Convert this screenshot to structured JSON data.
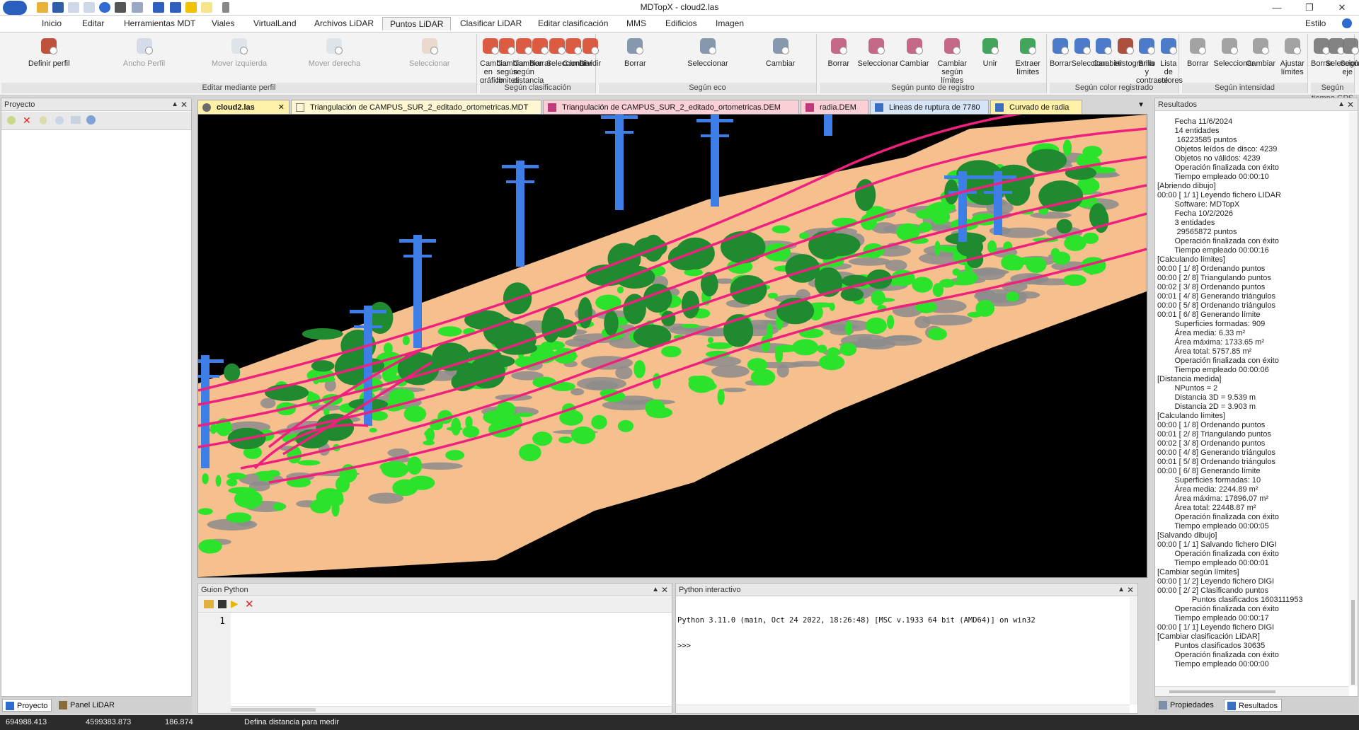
{
  "window": {
    "title": "MDTopX - cloud2.las",
    "controls": [
      "minimize-icon",
      "restore-icon",
      "close-icon"
    ]
  },
  "quick_access": [
    "app-logo-icon",
    "open-icon",
    "save-icon",
    "undo-icon",
    "redo-icon",
    "info-icon",
    "print-icon",
    "dropdown-icon",
    "forward-icon",
    "back-icon",
    "star-icon",
    "note-icon",
    "customize-icon"
  ],
  "menu": {
    "tabs": [
      "Inicio",
      "Editar",
      "Herramientas MDT",
      "Viales",
      "VirtualLand",
      "Archivos LiDAR",
      "Puntos LiDAR",
      "Clasificar LiDAR",
      "Editar clasificación",
      "MMS",
      "Edificios",
      "Imagen"
    ],
    "active": "Puntos LiDAR",
    "style_label": "Estilo"
  },
  "ribbon": {
    "groups": [
      {
        "label": "Editar mediante perfil",
        "buttons": [
          "Definir perfil",
          "Ancho Perfil",
          "Mover izquierda",
          "Mover derecha",
          "Seleccionar"
        ]
      },
      {
        "label": "Según clasificación",
        "buttons": [
          "Cambiar en gráfico",
          "Cambiar según límites",
          "Cambiar según distancia",
          "Borrar",
          "Seleccionar",
          "Cambiar",
          "Dividir"
        ]
      },
      {
        "label": "Según eco",
        "buttons": [
          "Borrar",
          "Seleccionar",
          "Cambiar"
        ]
      },
      {
        "label": "Según punto de registro",
        "buttons": [
          "Borrar",
          "Seleccionar",
          "Cambiar",
          "Cambiar según límites",
          "Unir",
          "Extraer límites"
        ]
      },
      {
        "label": "Según color registrado",
        "buttons": [
          "Borrar",
          "Seleccionar",
          "Cambiar",
          "Histograma",
          "Brillo y contraste",
          "Lista de colores"
        ]
      },
      {
        "label": "Según intensidad",
        "buttons": [
          "Borrar",
          "Seleccionar",
          "Cambiar",
          "Ajustar límites"
        ]
      },
      {
        "label": "Según tiempo GPS",
        "buttons": [
          "Borrar",
          "Seleccionar",
          "Según eje"
        ]
      }
    ]
  },
  "project_panel": {
    "title": "Proyecto",
    "bottom_tabs": [
      "Proyecto",
      "Panel LiDAR"
    ]
  },
  "document_tabs": [
    {
      "label": "cloud2.las",
      "active": true
    },
    {
      "label": "Triangulación de CAMPUS_SUR_2_editado_ortometricas.MDT",
      "active": false
    },
    {
      "label": "Triangulación de CAMPUS_SUR_2_editado_ortometricas.DEM",
      "active": false
    },
    {
      "label": "radia.DEM",
      "active": false
    },
    {
      "label": "Lineas de ruptura de 7780",
      "active": false
    },
    {
      "label": "Curvado de radia",
      "active": false
    }
  ],
  "guion_python": {
    "title": "Guion Python",
    "line_number": "1"
  },
  "python_interactive": {
    "title": "Python interactivo",
    "banner": "Python 3.11.0 (main, Oct 24 2022, 18:26:48) [MSC v.1933 64 bit (AMD64)] on win32",
    "prompt": ">>>"
  },
  "results_panel": {
    "title": "Resultados",
    "lines": [
      "        Fecha 11/6/2024",
      "        14 entidades",
      "         16223585 puntos",
      "        Objetos leídos de disco: 4239",
      "        Objetos no válidos: 4239",
      "        Operación finalizada con éxito",
      "        Tiempo empleado 00:00:10",
      "[Abriendo dibujo]",
      "00:00 [ 1/ 1] Leyendo fichero LIDAR",
      "        Software: MDTopX",
      "        Fecha 10/2/2026",
      "        3 entidades",
      "         29565872 puntos",
      "        Operación finalizada con éxito",
      "        Tiempo empleado 00:00:16",
      "[Calculando límites]",
      "00:00 [ 1/ 8] Ordenando puntos",
      "00:00 [ 2/ 8] Triangulando puntos",
      "00:02 [ 3/ 8] Ordenando puntos",
      "00:01 [ 4/ 8] Generando triángulos",
      "00:00 [ 5/ 8] Ordenando triángulos",
      "00:01 [ 6/ 8] Generando límite",
      "        Superficies formadas: 909",
      "        Área media: 6.33 m²",
      "        Área máxima: 1733.65 m²",
      "        Área total: 5757.85 m²",
      "        Operación finalizada con éxito",
      "        Tiempo empleado 00:00:06",
      "[Distancia medida]",
      "        NPuntos = 2",
      "        Distancia 3D = 9.539 m",
      "        Distancia 2D = 3.903 m",
      "[Calculando límites]",
      "00:00 [ 1/ 8] Ordenando puntos",
      "00:01 [ 2/ 8] Triangulando puntos",
      "00:02 [ 3/ 8] Ordenando puntos",
      "00:00 [ 4/ 8] Generando triángulos",
      "00:01 [ 5/ 8] Ordenando triángulos",
      "00:00 [ 6/ 8] Generando límite",
      "        Superficies formadas: 10",
      "        Área media: 2244.89 m²",
      "        Área máxima: 17896.07 m²",
      "        Área total: 22448.87 m²",
      "        Operación finalizada con éxito",
      "        Tiempo empleado 00:00:05",
      "[Salvando dibujo]",
      "00:00 [ 1/ 1] Salvando fichero DIGI",
      "        Operación finalizada con éxito",
      "        Tiempo empleado 00:00:01",
      "[Cambiar según límites]",
      "00:00 [ 1/ 2] Leyendo fichero DIGI",
      "00:00 [ 2/ 2] Clasificando puntos",
      "                Puntos clasificados 1603111953",
      "        Operación finalizada con éxito",
      "        Tiempo empleado 00:00:17",
      "00:00 [ 1/ 1] Leyendo fichero DIGI",
      "[Cambiar clasificación LiDAR]",
      "        Puntos clasificados 30635",
      "        Operación finalizada con éxito",
      "        Tiempo empleado 00:00:00"
    ],
    "bottom_tabs": [
      "Propiedades",
      "Resultados"
    ]
  },
  "status_bar": {
    "x": "694988.413",
    "y": "4599383.873",
    "z": "186.874",
    "message": "Defina distancia para medir"
  },
  "colors": {
    "ground": "#f6c08e",
    "low_veg": "#2ce32c",
    "high_veg": "#1f8a2f",
    "towers": "#3d7fe6",
    "wires": "#f0207f",
    "unclassified": "#8c8c8c"
  }
}
